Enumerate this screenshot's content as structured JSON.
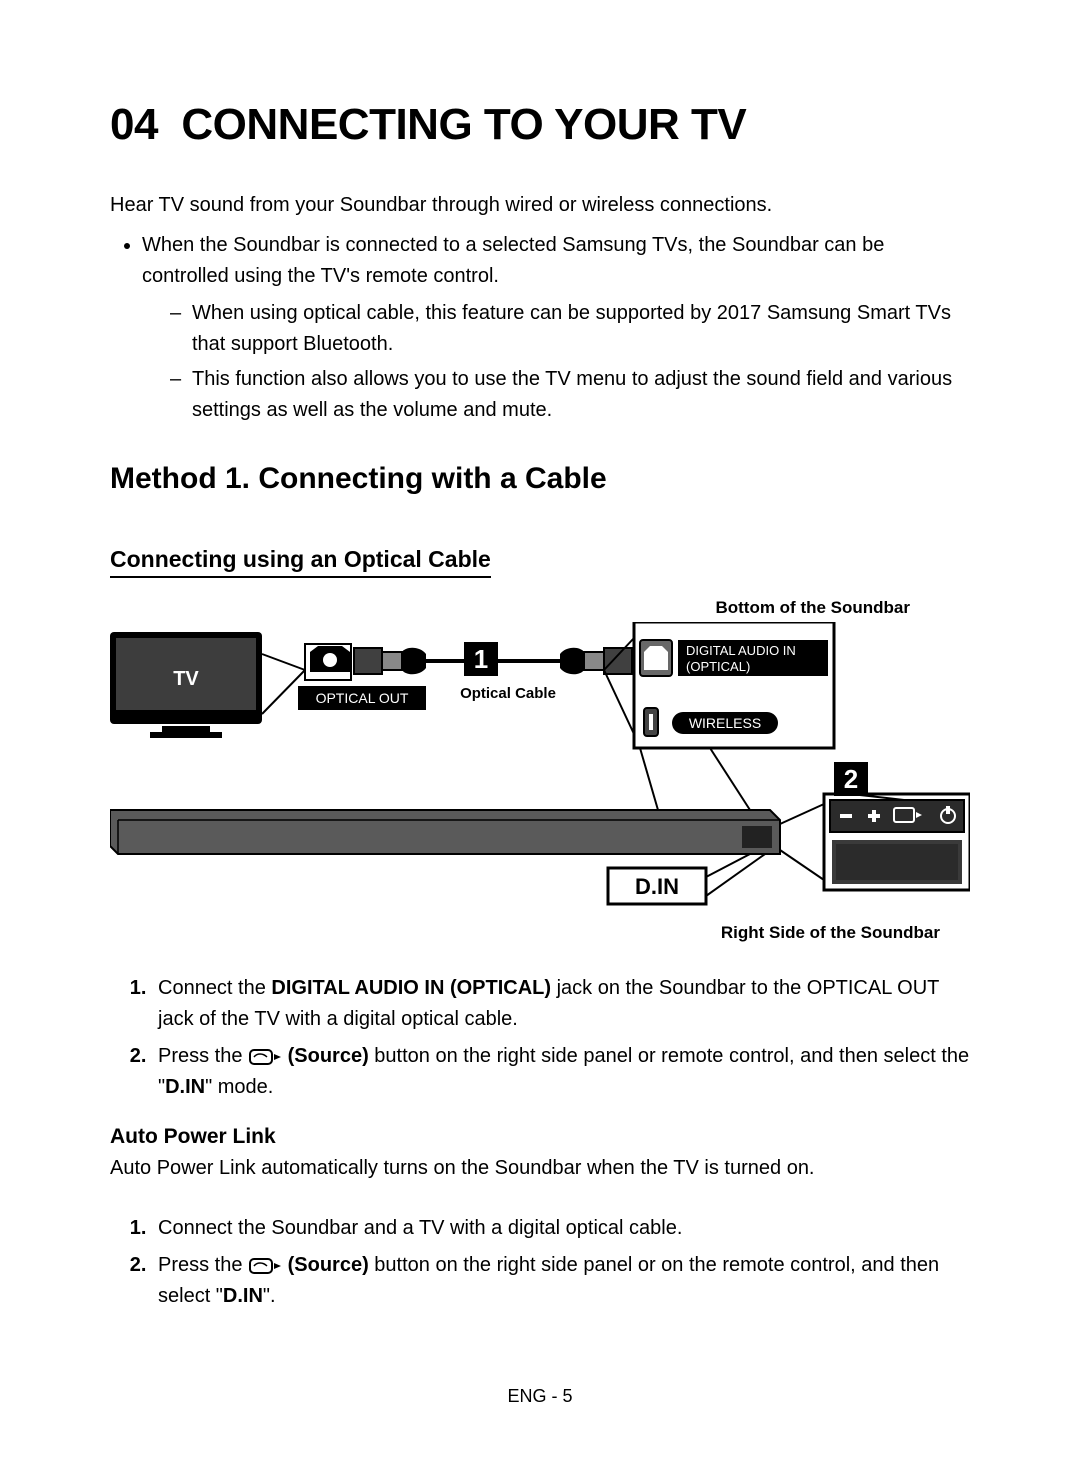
{
  "chapter_number": "04",
  "chapter_title": "CONNECTING TO YOUR TV",
  "intro": "Hear TV sound from your Soundbar through wired or wireless connections.",
  "bullet_main": "When the Soundbar is connected to a selected Samsung TVs, the Soundbar can be controlled using the TV's remote control.",
  "sub_bullets": [
    "When using optical cable, this feature can be supported by 2017 Samsung Smart TVs that support Bluetooth.",
    "This function also allows you to use the TV menu to adjust the sound field and various settings as well as the volume and mute."
  ],
  "method_heading": "Method 1. Connecting with a Cable",
  "subsection_heading": "Connecting using an Optical Cable",
  "diagram": {
    "top_caption": "Bottom of the Soundbar",
    "bottom_caption": "Right Side of the Soundbar",
    "tv_label": "TV",
    "optical_out": "OPTICAL OUT",
    "optical_cable": "Optical Cable",
    "digital_in_line1": "DIGITAL AUDIO IN",
    "digital_in_line2": "(OPTICAL)",
    "wireless": "WIRELESS",
    "din": "D.IN",
    "callout1": "1",
    "callout2": "2"
  },
  "steps_a": [
    {
      "pre": "Connect the ",
      "bold1": "DIGITAL AUDIO IN (OPTICAL)",
      "post": " jack on the Soundbar to the OPTICAL OUT jack of the TV with a digital optical cable."
    },
    {
      "pre": "Press the ",
      "bold1": "(Source)",
      "mid": " button on the right side panel or remote control, and then select the \"",
      "bold2": "D.IN",
      "post": "\" mode."
    }
  ],
  "feature_heading": "Auto Power Link",
  "feature_desc": "Auto Power Link automatically turns on the Soundbar when the TV is turned on.",
  "steps_b": [
    {
      "text": "Connect the Soundbar and a TV with a digital optical cable."
    },
    {
      "pre": "Press the ",
      "bold1": "(Source)",
      "mid": " button on the right side panel or on the remote control, and then select \"",
      "bold2": "D.IN",
      "post": "\"."
    }
  ],
  "footer": "ENG - 5"
}
